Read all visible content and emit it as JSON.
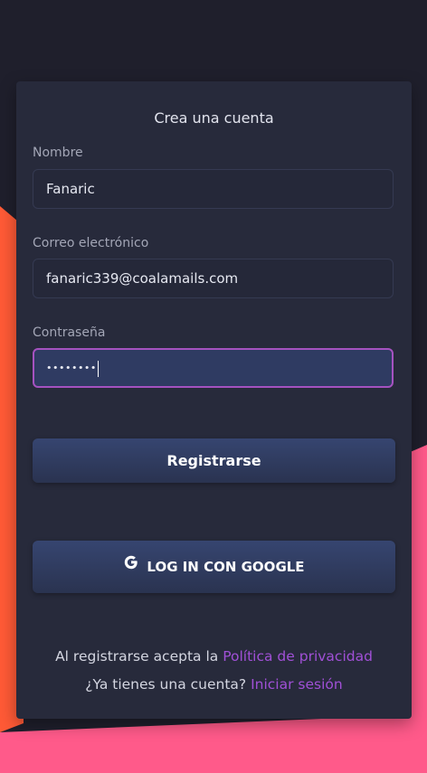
{
  "colors": {
    "background": "#1f1f2c",
    "card": "#272a3b",
    "accent_orange": "#ff5a36",
    "accent_pink": "#ff5a8a",
    "link": "#a050d6",
    "button": "#334068"
  },
  "form": {
    "title": "Crea una cuenta",
    "name_label": "Nombre",
    "name_value": "Fanaric",
    "email_label": "Correo electrónico",
    "email_value": "fanaric339@coalamails.com",
    "password_label": "Contraseña",
    "password_masked": "••••••••",
    "register_button": "Registrarse",
    "google_button": "LOG IN CON GOOGLE",
    "google_icon": "google-g-icon"
  },
  "footer": {
    "terms_prefix": "Al registrarse acepta la",
    "privacy_link": "Política de privacidad",
    "login_prefix": "¿Ya tienes una cuenta?",
    "login_link": "Iniciar sesión"
  }
}
